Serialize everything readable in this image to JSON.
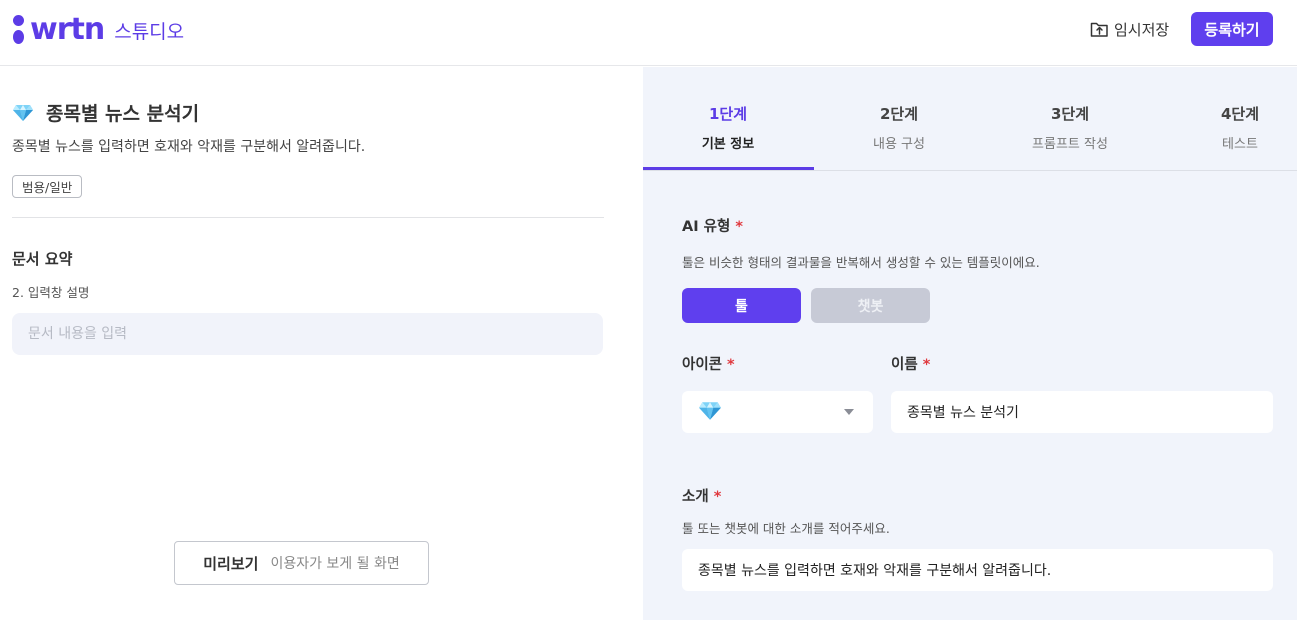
{
  "header": {
    "logo_text": "wrtn",
    "logo_sub": "스튜디오",
    "save_label": "임시저장",
    "register_label": "등록하기",
    "accent_color": "#5f3fee"
  },
  "left": {
    "tool_icon": "gem-icon",
    "tool_title": "종목별 뉴스 분석기",
    "tool_description": "종목별 뉴스를 입력하면 호재와 악재를 구분해서 알려줍니다.",
    "tag": "범용/일반",
    "section_title": "문서 요약",
    "section_subtitle": "2. 입력창 설명",
    "input_placeholder": "문서 내용을 입력",
    "preview_label": "미리보기",
    "preview_hint": "이용자가 보게 될 화면"
  },
  "steps": [
    {
      "step": "1단계",
      "name": "기본 정보",
      "active": true
    },
    {
      "step": "2단계",
      "name": "내용 구성",
      "active": false
    },
    {
      "step": "3단계",
      "name": "프롬프트 작성",
      "active": false
    },
    {
      "step": "4단계",
      "name": "테스트",
      "active": false
    }
  ],
  "form": {
    "required_mark": "*",
    "ai_type_label": "AI 유형",
    "ai_type_hint": "툴은 비슷한 형태의 결과물을 반복해서 생성할 수 있는 템플릿이에요.",
    "type_tool": "툴",
    "type_chatbot": "챗봇",
    "selected_type": "툴",
    "icon_label": "아이콘",
    "selected_icon": "gem-icon",
    "name_label": "이름",
    "name_value": "종목별 뉴스 분석기",
    "intro_label": "소개",
    "intro_hint": "툴 또는 챗봇에 대한 소개를 적어주세요.",
    "intro_value": "종목별 뉴스를 입력하면 호재와 악재를 구분해서 알려줍니다."
  }
}
